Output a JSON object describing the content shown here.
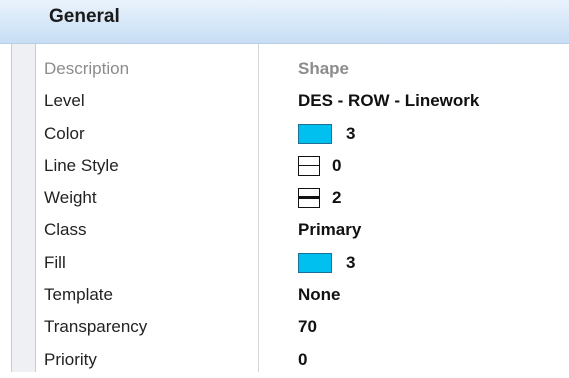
{
  "section": {
    "title": "General"
  },
  "properties": [
    {
      "key": "description",
      "label": "Description",
      "value": "Shape"
    },
    {
      "key": "level",
      "label": "Level",
      "value": "DES - ROW - Linework"
    },
    {
      "key": "color",
      "label": "Color",
      "value": "3",
      "swatch": "#00c0f0",
      "icon": "color-swatch"
    },
    {
      "key": "line_style",
      "label": "Line Style",
      "value": "0",
      "icon": "line-style-icon"
    },
    {
      "key": "weight",
      "label": "Weight",
      "value": "2",
      "icon": "line-weight-icon"
    },
    {
      "key": "class",
      "label": "Class",
      "value": "Primary"
    },
    {
      "key": "fill",
      "label": "Fill",
      "value": "3",
      "swatch": "#00c0f0",
      "icon": "color-swatch"
    },
    {
      "key": "template",
      "label": "Template",
      "value": "None"
    },
    {
      "key": "transparency",
      "label": "Transparency",
      "value": "70"
    },
    {
      "key": "priority",
      "label": "Priority",
      "value": "0"
    }
  ]
}
